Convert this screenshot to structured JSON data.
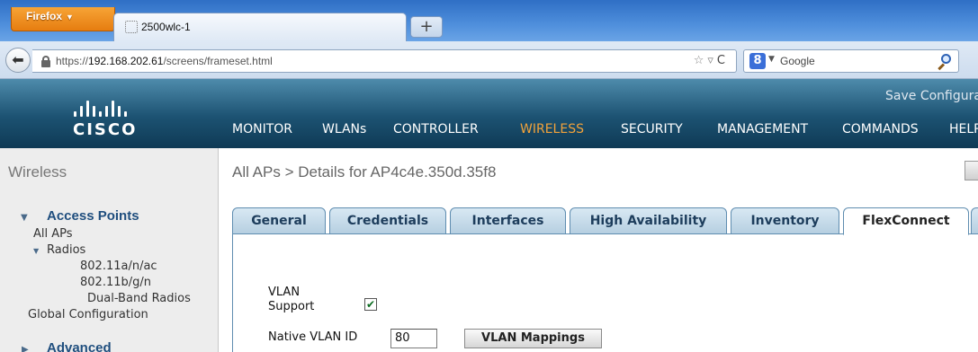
{
  "browser": {
    "firefox_button": "Firefox",
    "tab_title": "2500wlc-1",
    "new_tab": "+",
    "url_scheme": "https://",
    "url_host": "192.168.202.61",
    "url_path": "/screens/frameset.html",
    "search_engine": "Google",
    "search_engine_icon": "8"
  },
  "header": {
    "brand": "CISCO",
    "save_config": "Save Configuration",
    "menu": [
      {
        "label": "MONITOR",
        "active": false
      },
      {
        "label": "WLANs",
        "active": false
      },
      {
        "label": "CONTROLLER",
        "active": false
      },
      {
        "label": "WIRELESS",
        "active": true
      },
      {
        "label": "SECURITY",
        "active": false
      },
      {
        "label": "MANAGEMENT",
        "active": false
      },
      {
        "label": "COMMANDS",
        "active": false
      },
      {
        "label": "HELP",
        "active": false
      }
    ],
    "accent_color": "#f2a23a"
  },
  "sidebar": {
    "title": "Wireless",
    "sections": [
      {
        "label": "Access Points",
        "expanded": true
      },
      {
        "label": "Advanced",
        "expanded": false
      }
    ],
    "links": {
      "all_aps": "All APs",
      "radios": "Radios",
      "radio_a": "802.11a/n/ac",
      "radio_b": "802.11b/g/n",
      "dual_band": "Dual-Band Radios",
      "global_config": "Global Configuration"
    }
  },
  "main": {
    "title": "All APs > Details for AP4c4e.350d.35f8",
    "tabs": [
      {
        "label": "General"
      },
      {
        "label": "Credentials"
      },
      {
        "label": "Interfaces"
      },
      {
        "label": "High Availability"
      },
      {
        "label": "Inventory"
      },
      {
        "label": "FlexConnect",
        "active": true
      }
    ],
    "vlan_support_label_1": "VLAN",
    "vlan_support_label_2": "Support",
    "vlan_support_checked": true,
    "native_vlan_label": "Native VLAN ID",
    "native_vlan_value": "80",
    "vlan_mappings_button": "VLAN Mappings"
  }
}
